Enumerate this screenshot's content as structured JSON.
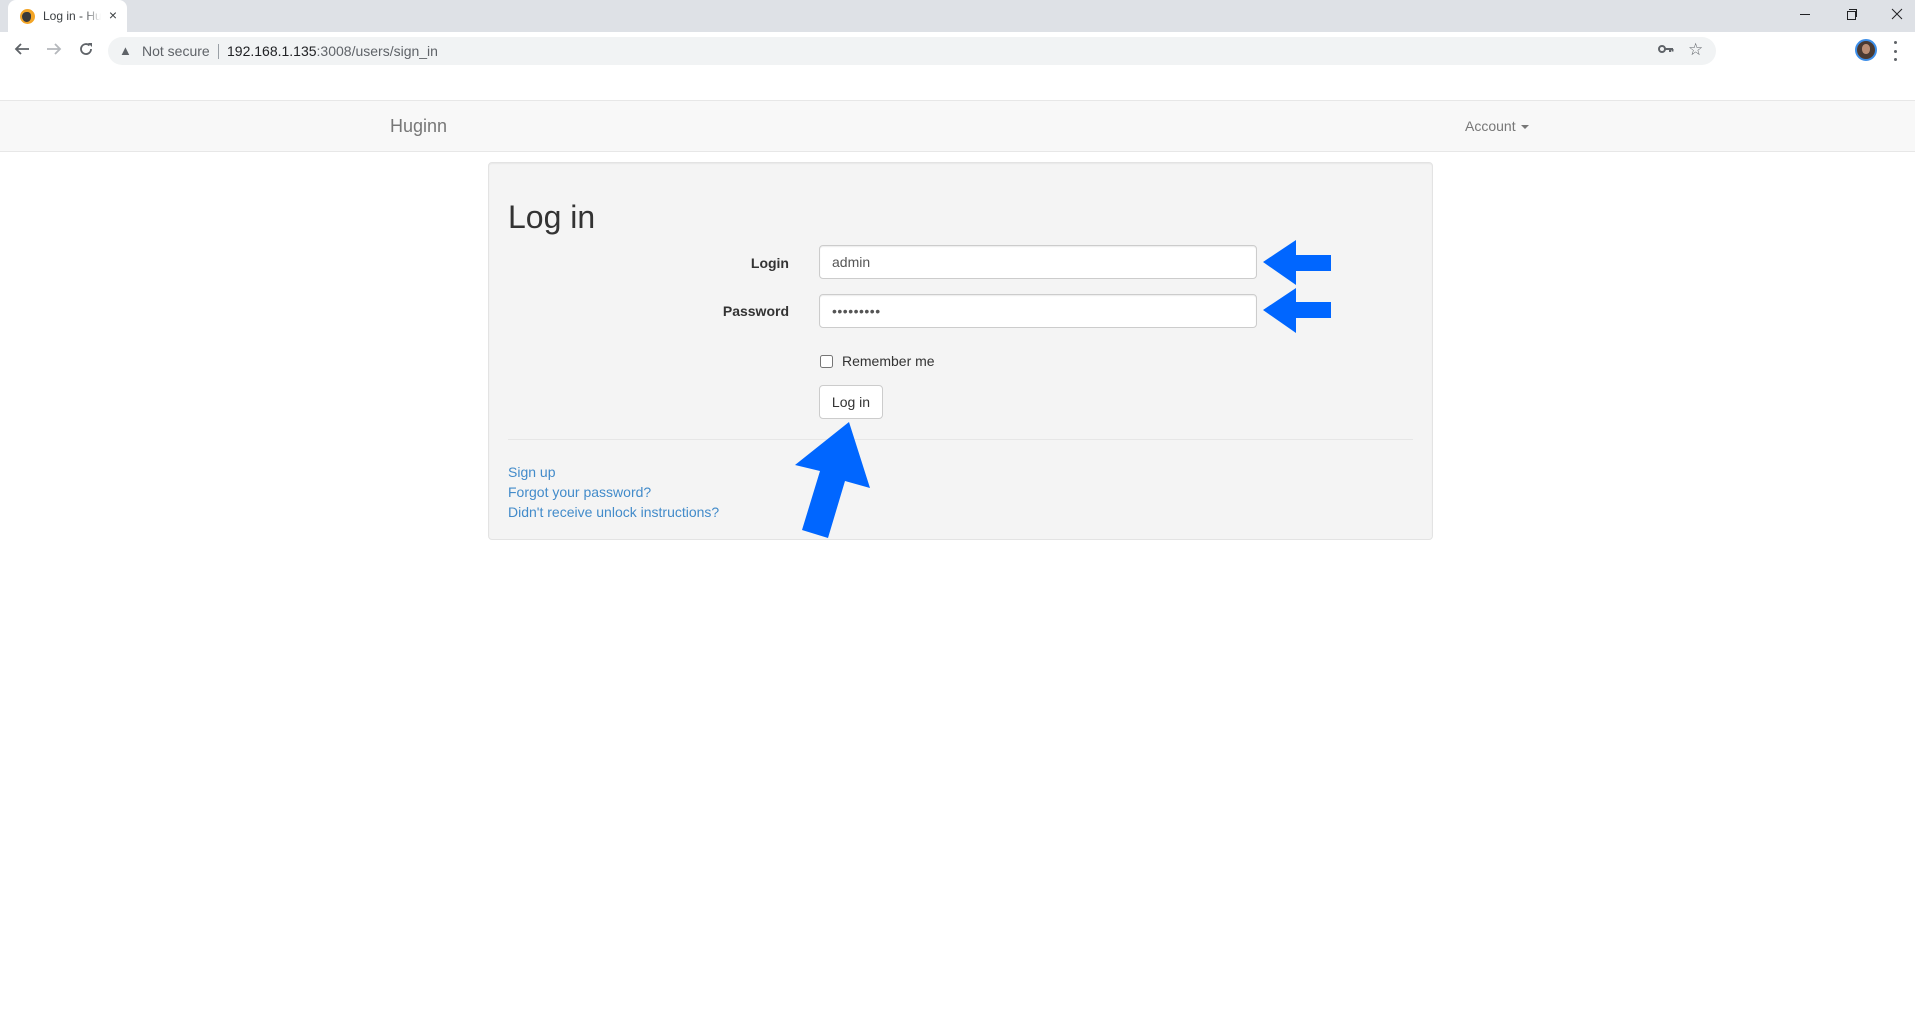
{
  "browser": {
    "tab_title": "Log in - Huginn",
    "tab_close_icon": "×",
    "not_secure_label": "Not secure",
    "url_host": "192.168.1.135",
    "url_path": ":3008/users/sign_in",
    "icons": {
      "back": "←",
      "forward": "→",
      "reload": "↻",
      "warning": "▲",
      "key": "⚿",
      "star": "☆",
      "close_window": "✕"
    }
  },
  "navbar": {
    "brand": "Huginn",
    "account_label": "Account"
  },
  "login_form": {
    "heading": "Log in",
    "login_label": "Login",
    "login_value": "admin",
    "password_label": "Password",
    "password_value": "•••••••••",
    "remember_label": "Remember me",
    "remember_checked": false,
    "submit_label": "Log in"
  },
  "links": [
    {
      "label": "Sign up"
    },
    {
      "label": "Forgot your password?"
    },
    {
      "label": "Didn't receive unlock instructions?"
    }
  ],
  "annotations": {
    "arrow_color": "#0066ff"
  }
}
